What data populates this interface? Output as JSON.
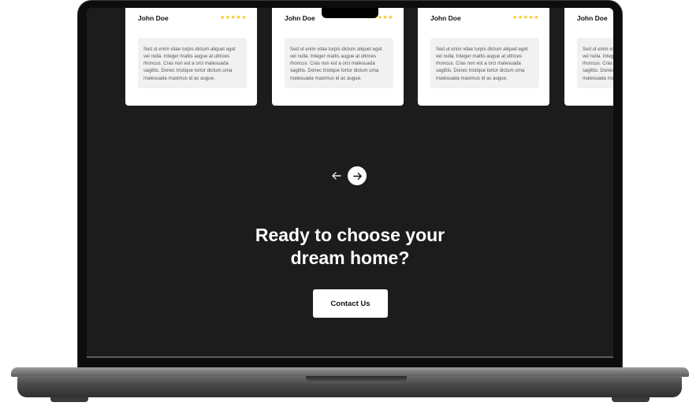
{
  "testimonials": [
    {
      "name": "John Doe",
      "stars": "★★★★★",
      "quote": "Sed ut enim vitae turpis dictum aliquet eget vel nulla. Integer mattis augue at ultrices rhoncus. Cras non est a orci malesuada sagittis. Donec tristique tortor dictum urna malesuada maximus id ac augue."
    },
    {
      "name": "John Doe",
      "stars": "★★★★★",
      "quote": "Sed ut enim vitae turpis dictum aliquet eget vel nulla. Integer mattis augue at ultrices rhoncus. Cras non est a orci malesuada sagittis. Donec tristique tortor dictum urna malesuada maximus id ac augue."
    },
    {
      "name": "John Doe",
      "stars": "★★★★★",
      "quote": "Sed ut enim vitae turpis dictum aliquet eget vel nulla. Integer mattis augue at ultrices rhoncus. Cras non est a orci malesuada sagittis. Donec tristique tortor dictum urna malesuada maximus id ac augue."
    },
    {
      "name": "John Doe",
      "stars": "★★★★★",
      "quote": "Sed ut enim vitae turpis dictum aliquet eget vel nulla. Integer mattis augue at ultrices rhoncus. Cras non est a orci malesuada sagittis. Donec tristique tortor dictum urna malesuada maximus id ac augue."
    }
  ],
  "carousel": {
    "prev_icon": "arrow-left-icon",
    "next_icon": "arrow-right-icon"
  },
  "cta": {
    "heading_line1": "Ready to choose your",
    "heading_line2": "dream home?",
    "button_label": "Contact Us"
  },
  "colors": {
    "screen_background": "#1c1c1c",
    "star": "#f5c518",
    "card": "#ffffff"
  }
}
